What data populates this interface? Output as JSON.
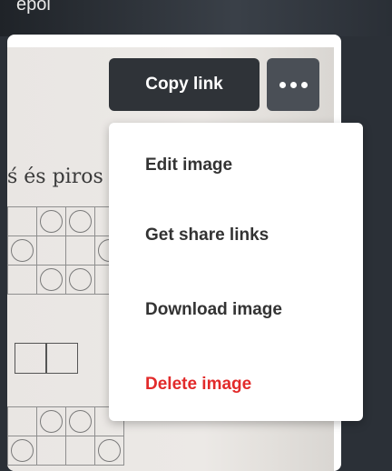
{
  "background_text": "epoi",
  "photo": {
    "text_fragment": "ś és piros s"
  },
  "toolbar": {
    "copy_link_label": "Copy link",
    "more_icon": "more-dots-icon"
  },
  "menu": {
    "items": [
      {
        "label": "Edit image"
      },
      {
        "label": "Get share links"
      },
      {
        "label": "Download image"
      },
      {
        "label": "Delete image",
        "color": "#e22a2a"
      }
    ]
  }
}
